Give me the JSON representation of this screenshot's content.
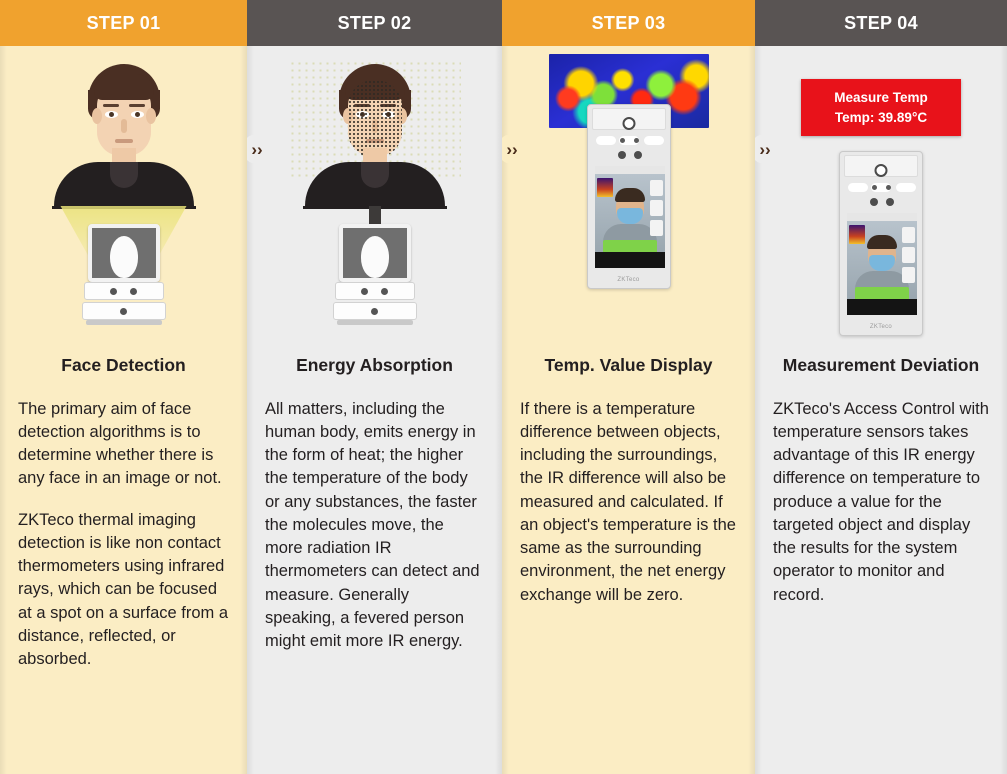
{
  "columns": [
    {
      "step_label": "STEP 01",
      "header_color": "#F0A22E",
      "body_color": "#FBEDC4",
      "title": "Face Detection",
      "paragraphs": [
        "The primary aim of face detection algorithms is to determine whether there is any face in an image or not.",
        "ZKTeco thermal imaging detection is like non contact thermometers using infrared rays, which can be focused at a spot on a surface from a distance, reflected, or absorbed."
      ],
      "illustration": "person-with-light-cone-and-scanner"
    },
    {
      "step_label": "STEP 02",
      "header_color": "#595453",
      "body_color": "#EDEDED",
      "title": "Energy Absorption",
      "paragraphs": [
        "All matters, including the human body, emits energy in the form of heat; the higher the temperature of the body or any substances, the faster the molecules move, the more radiation IR thermometers can detect and measure. Generally speaking, a fevered person might emit more IR energy."
      ],
      "illustration": "face-mesh-with-arrow-and-scanner"
    },
    {
      "step_label": "STEP 03",
      "header_color": "#F0A22E",
      "body_color": "#FBEDC4",
      "title": "Temp. Value Display",
      "paragraphs": [
        "If there is a temperature difference between objects, including the surroundings, the IR difference will also be measured and calculated. If an object's temperature is the same as the surrounding environment, the net energy exchange will be zero."
      ],
      "illustration": "thermal-heatmap-with-terminal"
    },
    {
      "step_label": "STEP 04",
      "header_color": "#595453",
      "body_color": "#EDEDED",
      "title": "Measurement Deviation",
      "paragraphs": [
        "ZKTeco's Access Control with temperature sensors takes advantage of this IR energy difference on temperature to produce a value for the targeted object and display the results for the system operator to monitor and record."
      ],
      "illustration": "terminal-with-temperature-badge"
    }
  ],
  "badge": {
    "line1": "Measure Temp",
    "line2": "Temp: 39.89°C",
    "color": "#E8121A"
  },
  "connectors": [
    {
      "glyph": "››",
      "name": "chevron-1-2"
    },
    {
      "glyph": "››",
      "name": "chevron-2-3"
    },
    {
      "glyph": "››",
      "name": "chevron-3-4"
    }
  ]
}
